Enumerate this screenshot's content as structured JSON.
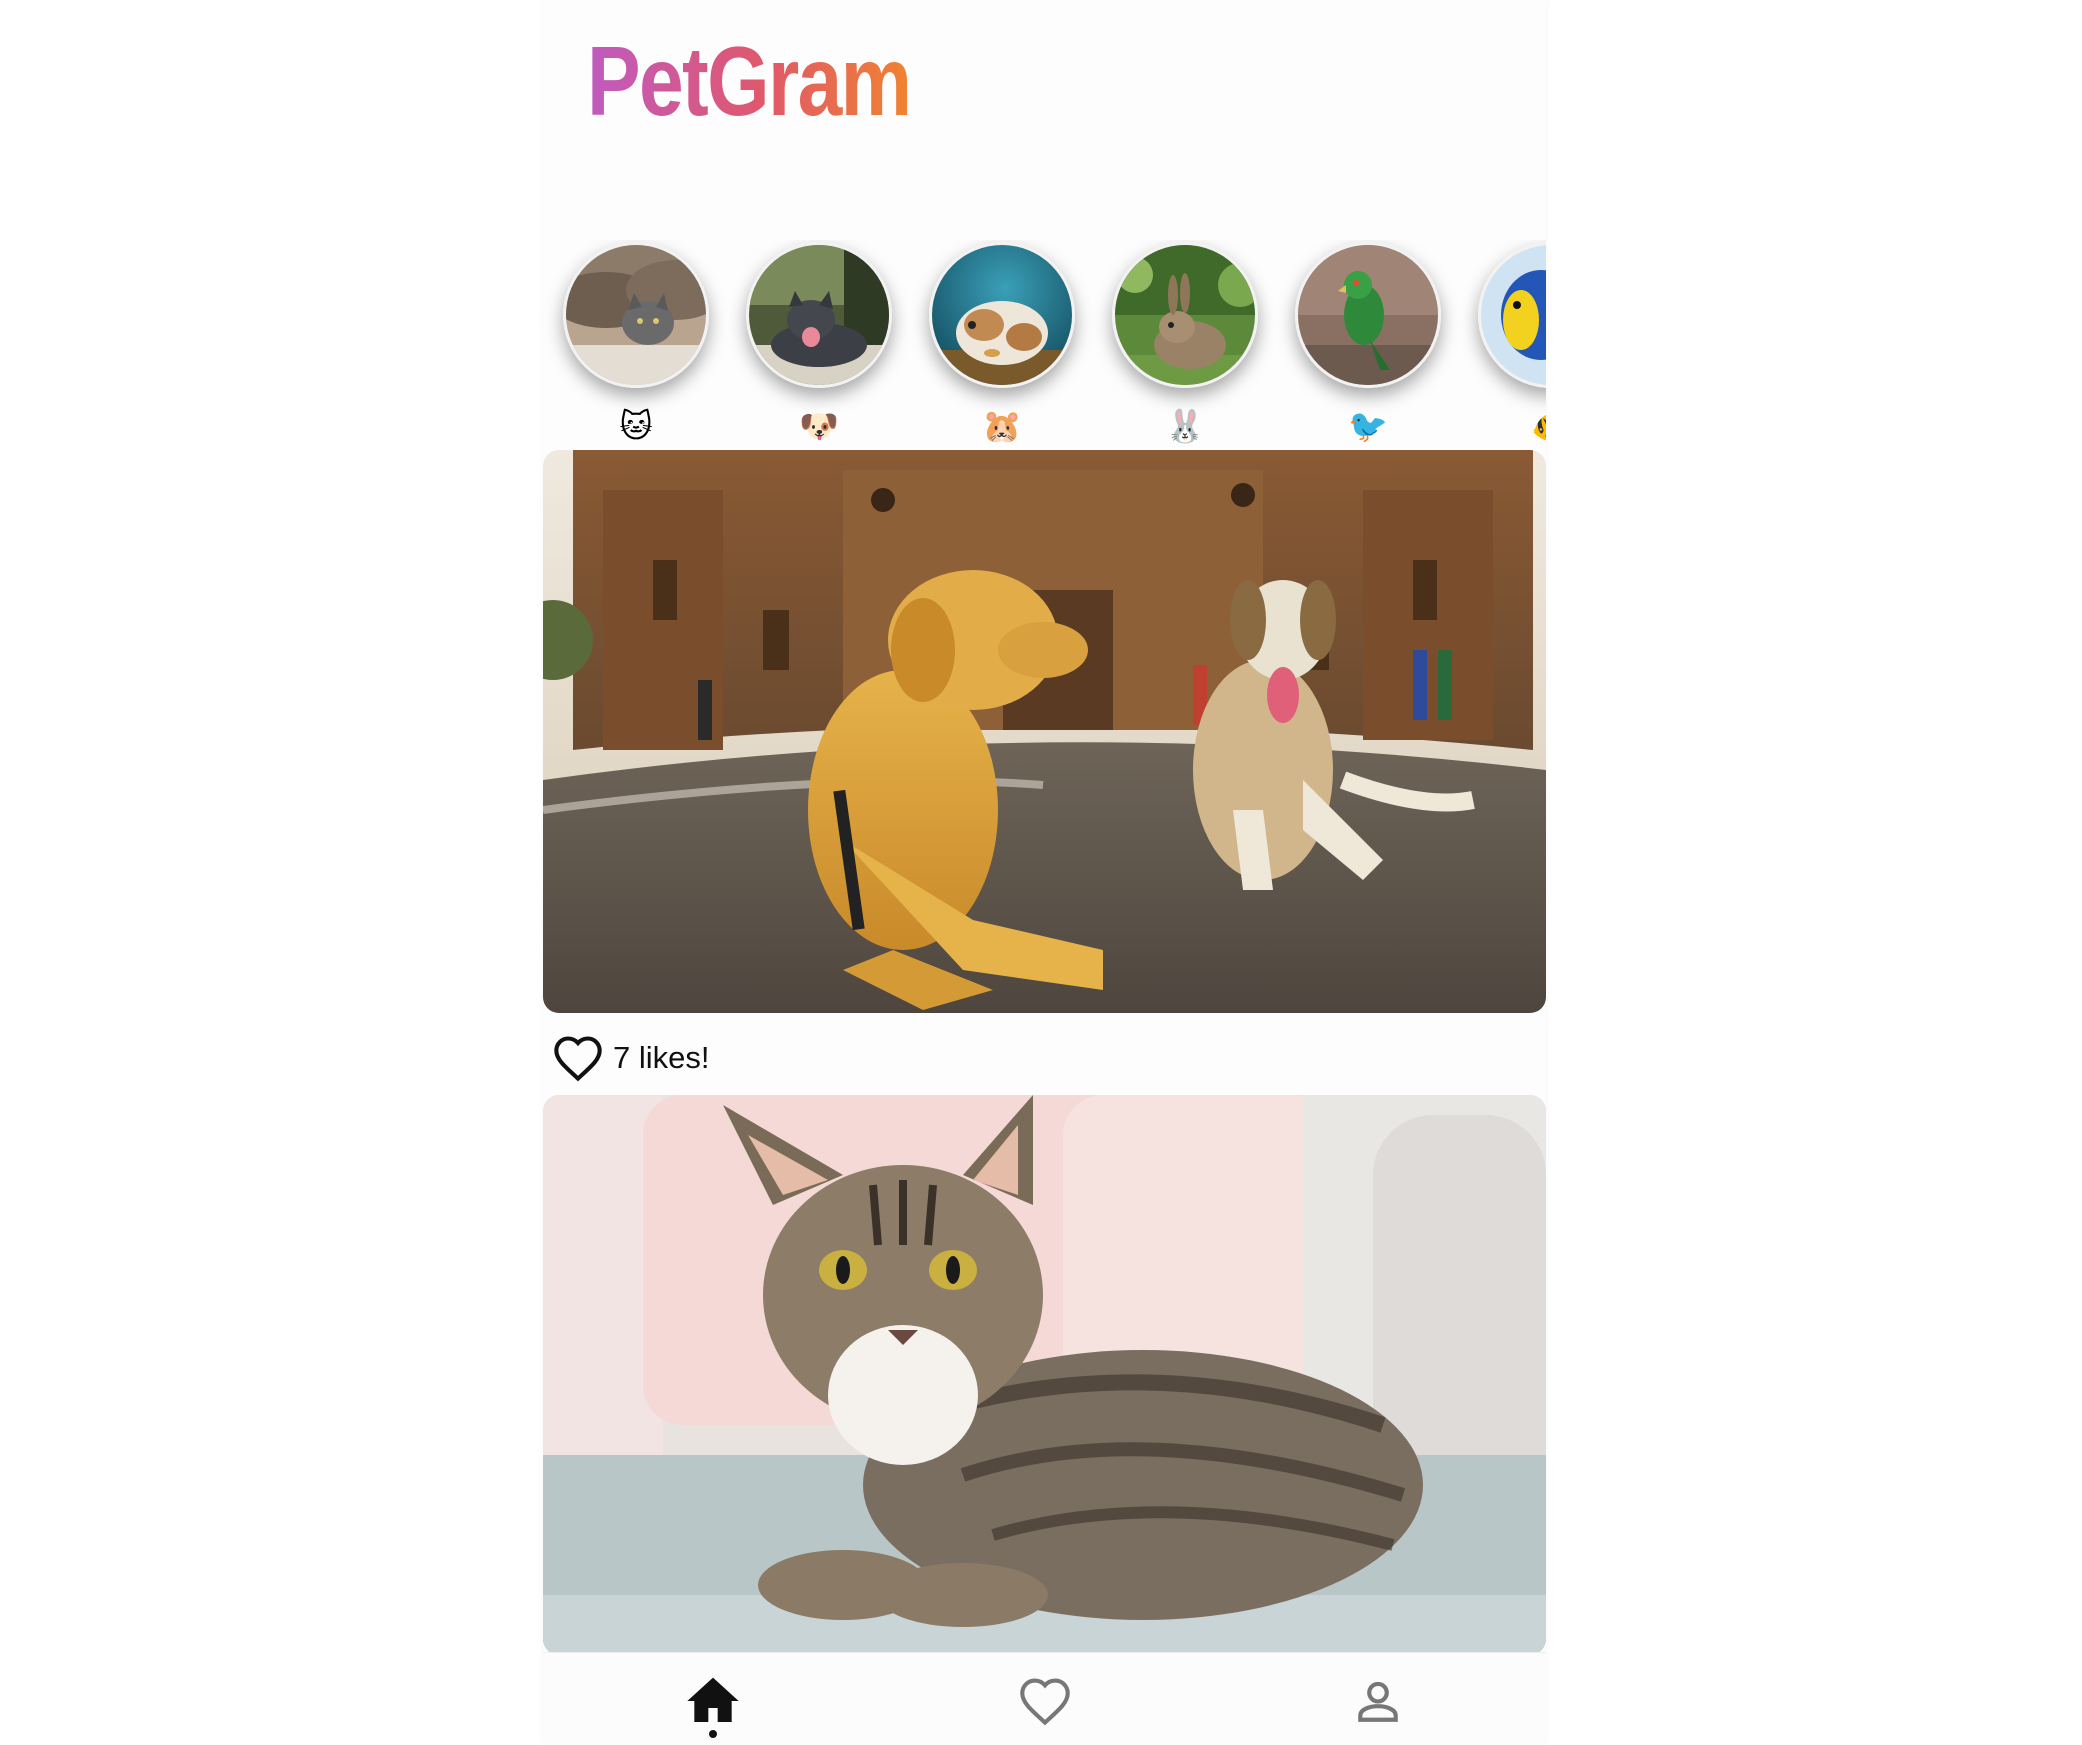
{
  "app": {
    "logo_text": "PetGram"
  },
  "stories": [
    {
      "emoji": "🐱",
      "animal": "cat"
    },
    {
      "emoji": "🐶",
      "animal": "dog"
    },
    {
      "emoji": "🐹",
      "animal": "hamster"
    },
    {
      "emoji": "🐰",
      "animal": "rabbit"
    },
    {
      "emoji": "🐦",
      "animal": "bird"
    },
    {
      "emoji": "🐠",
      "animal": "fish"
    }
  ],
  "posts": [
    {
      "subject": "two dogs lying in front of a cathedral",
      "likes_label": "7 likes!"
    },
    {
      "subject": "tabby cat lying on a sofa"
    }
  ],
  "bottom_nav": {
    "items": [
      "home-icon",
      "heart-icon",
      "user-icon"
    ],
    "active": "home-icon"
  },
  "colors": {
    "logo_gradient_start": "#c05ac1",
    "logo_gradient_mid": "#e0586a",
    "logo_gradient_end": "#f08330",
    "icon": "#111111",
    "inactive_icon": "#777777"
  }
}
